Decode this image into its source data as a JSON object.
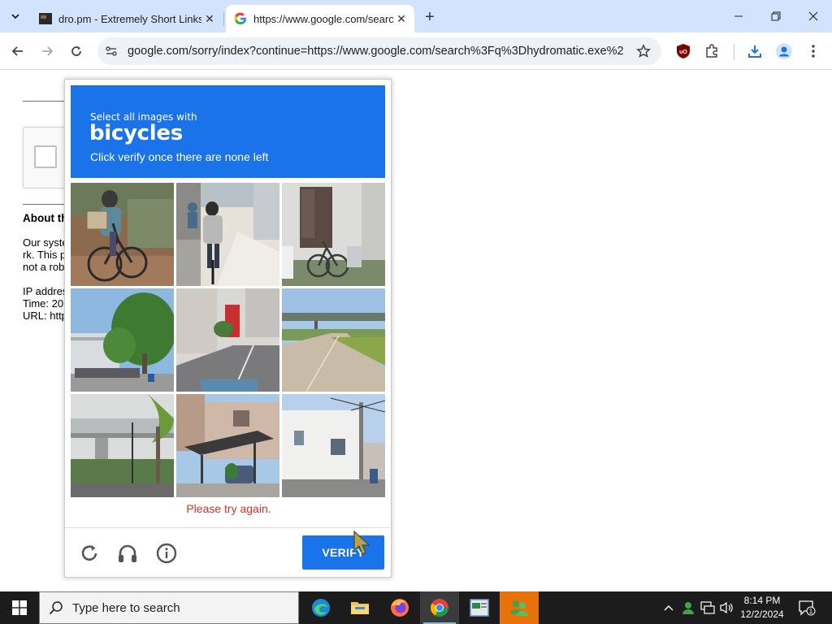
{
  "browser": {
    "tabs": [
      {
        "title": "dro.pm - Extremely Short Links",
        "active": false
      },
      {
        "title": "https://www.google.com/search",
        "active": true
      }
    ],
    "url": "google.com/sorry/index?continue=https://www.google.com/search%3Fq%3Dhydromatic.exe%26..."
  },
  "page": {
    "heading": "About th",
    "para_lines": [
      "Our syste",
      "rk. This p",
      "not a rob"
    ],
    "info_lines": [
      "IP addres",
      "Time: 20",
      "URL: http"
    ]
  },
  "captcha": {
    "instruction_small": "Select all images with",
    "target": "bicycles",
    "instruction_sub": "Click verify once there are none left",
    "error": "Please try again.",
    "verify_label": "VERIFY",
    "tiles": [
      {
        "subject": "person riding bicycle with basket"
      },
      {
        "subject": "cyclist on sidewalk"
      },
      {
        "subject": "bicycle parked by building"
      },
      {
        "subject": "trees and parked bicycles"
      },
      {
        "subject": "street with red vending machine"
      },
      {
        "subject": "bike path under overpass"
      },
      {
        "subject": "elevated highway and palm tree"
      },
      {
        "subject": "house with carport"
      },
      {
        "subject": "white house with utility pole"
      }
    ]
  },
  "taskbar": {
    "search_placeholder": "Type here to search",
    "time": "8:14 PM",
    "date": "12/2/2024",
    "notification_count": "1"
  },
  "colors": {
    "accent": "#1a73e8",
    "error": "#d93025",
    "tabstrip": "#d3e3fd"
  }
}
